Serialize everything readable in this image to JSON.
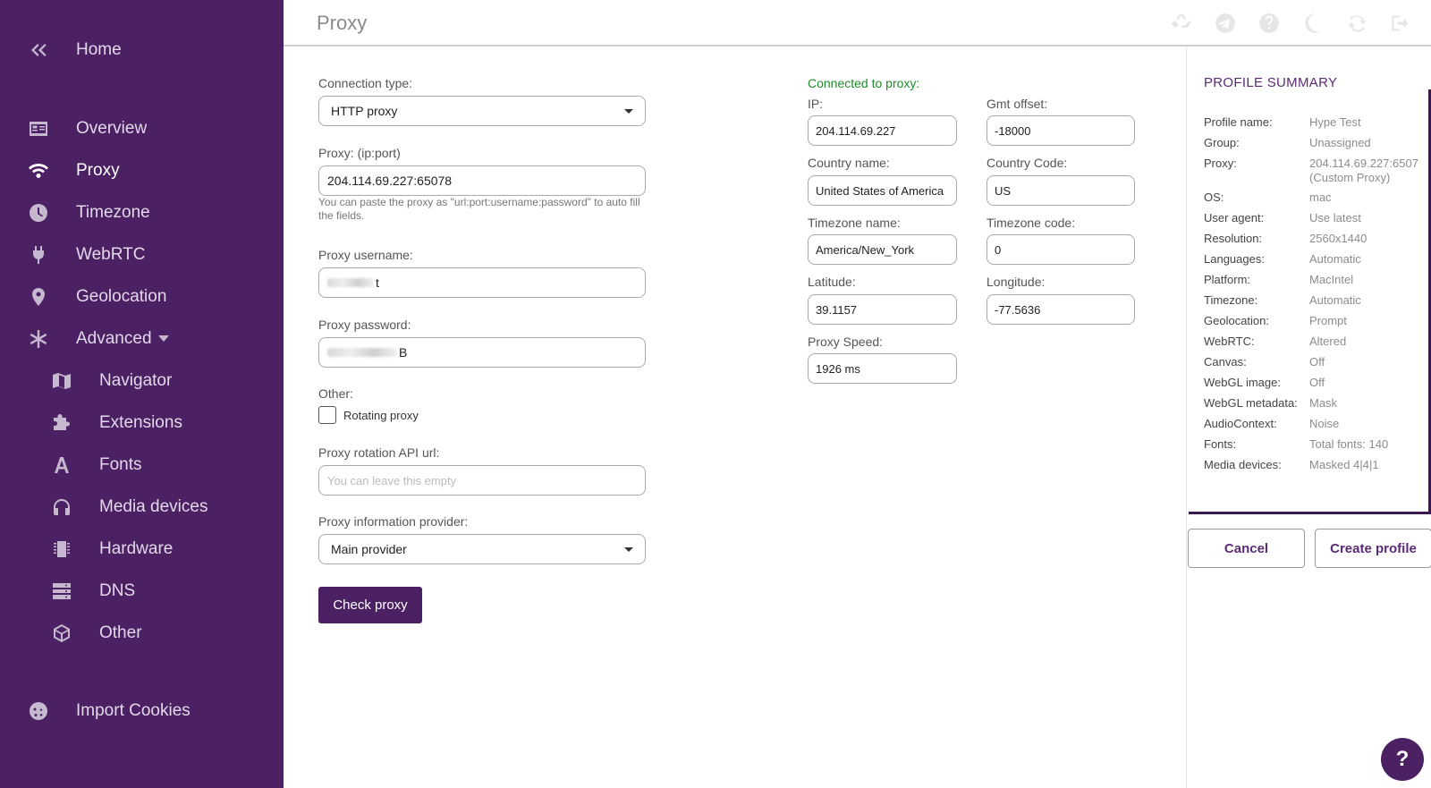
{
  "sidebar": {
    "home": "Home",
    "overview": "Overview",
    "proxy": "Proxy",
    "timezone": "Timezone",
    "webrtc": "WebRTC",
    "geolocation": "Geolocation",
    "advanced": "Advanced",
    "navigator": "Navigator",
    "extensions": "Extensions",
    "fonts": "Fonts",
    "media_devices": "Media devices",
    "hardware": "Hardware",
    "dns": "DNS",
    "other": "Other",
    "import_cookies": "Import Cookies"
  },
  "header": {
    "title": "Proxy"
  },
  "form": {
    "connection_type_label": "Connection type:",
    "connection_type_value": "HTTP proxy",
    "proxy_label": "Proxy: (ip:port)",
    "proxy_value": "204.114.69.227:65078",
    "proxy_help": "You can paste the proxy as \"url:port:username:password\" to auto fill the fields.",
    "username_label": "Proxy username:",
    "username_visible_tail": "t",
    "password_label": "Proxy password:",
    "password_visible_tail": "B",
    "other_label": "Other:",
    "rotating_label": "Rotating proxy",
    "rotating_checked": false,
    "rotation_api_label": "Proxy rotation API url:",
    "rotation_api_placeholder": "You can leave this empty",
    "provider_label": "Proxy information provider:",
    "provider_value": "Main provider",
    "check_button": "Check proxy"
  },
  "connection": {
    "status": "Connected to proxy:",
    "ip_label": "IP:",
    "ip_value": "204.114.69.227",
    "gmt_label": "Gmt offset:",
    "gmt_value": "-18000",
    "country_name_label": "Country name:",
    "country_name_value": "United States of America",
    "country_code_label": "Country Code:",
    "country_code_value": "US",
    "tz_name_label": "Timezone name:",
    "tz_name_value": "America/New_York",
    "tz_code_label": "Timezone code:",
    "tz_code_value": "0",
    "lat_label": "Latitude:",
    "lat_value": "39.1157",
    "lon_label": "Longitude:",
    "lon_value": "-77.5636",
    "speed_label": "Proxy Speed:",
    "speed_value": "1926 ms"
  },
  "summary": {
    "title": "PROFILE SUMMARY",
    "rows": [
      {
        "k": "Profile name:",
        "v": "Hype Test"
      },
      {
        "k": "Group:",
        "v": "Unassigned"
      },
      {
        "k": "Proxy:",
        "v": "204.114.69.227:6507",
        "v2": "(Custom Proxy)"
      },
      {
        "k": "OS:",
        "v": "mac"
      },
      {
        "k": "User agent:",
        "v": "Use latest"
      },
      {
        "k": "Resolution:",
        "v": "2560x1440"
      },
      {
        "k": "Languages:",
        "v": "Automatic"
      },
      {
        "k": "Platform:",
        "v": "MacIntel"
      },
      {
        "k": "Timezone:",
        "v": "Automatic"
      },
      {
        "k": "Geolocation:",
        "v": "Prompt"
      },
      {
        "k": "WebRTC:",
        "v": "Altered"
      },
      {
        "k": "Canvas:",
        "v": "Off"
      },
      {
        "k": "WebGL image:",
        "v": "Off"
      },
      {
        "k": "WebGL metadata:",
        "v": "Mask"
      },
      {
        "k": "AudioContext:",
        "v": "Noise"
      },
      {
        "k": "Fonts:",
        "v": "Total fonts: 140"
      },
      {
        "k": "Media devices:",
        "v": "Masked 4|4|1"
      }
    ],
    "cancel": "Cancel",
    "create": "Create profile"
  },
  "help_fab": "?",
  "colors": {
    "sidebar": "#4b2163",
    "accent": "#5b2a74",
    "connected": "#1f8a2a"
  },
  "icons": [
    "double-chevron-left-icon",
    "id-card-icon",
    "wifi-icon",
    "clock-icon",
    "plug-icon",
    "map-pin-icon",
    "asterisk-icon",
    "map-icon",
    "puzzle-icon",
    "font-icon",
    "headphones-icon",
    "chip-icon",
    "server-icon",
    "cube-icon",
    "cookie-icon",
    "recycle-icon",
    "telegram-icon",
    "question-icon",
    "moon-icon",
    "sync-icon",
    "sign-out-icon"
  ]
}
